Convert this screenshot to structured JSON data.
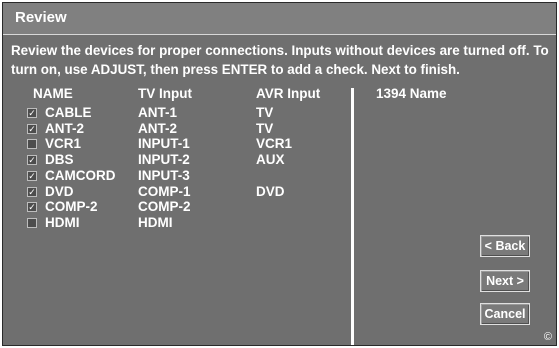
{
  "window": {
    "title": "Review"
  },
  "instructions": "Review the devices for proper connections. Inputs without devices are turned off. To turn on, use ADJUST, then press ENTER to add a check. Next to finish.",
  "columns": {
    "name": "NAME",
    "tv_input": "TV  Input",
    "avr_input": "AVR Input",
    "name_1394": "1394 Name"
  },
  "devices": [
    {
      "checked": true,
      "name": "CABLE",
      "tv_input": "ANT-1",
      "avr_input": "TV"
    },
    {
      "checked": true,
      "name": "ANT-2",
      "tv_input": "ANT-2",
      "avr_input": "TV"
    },
    {
      "checked": false,
      "name": "VCR1",
      "tv_input": "INPUT-1",
      "avr_input": "VCR1"
    },
    {
      "checked": true,
      "name": "DBS",
      "tv_input": "INPUT-2",
      "avr_input": "AUX"
    },
    {
      "checked": true,
      "name": "CAMCORD",
      "tv_input": "INPUT-3",
      "avr_input": ""
    },
    {
      "checked": true,
      "name": "DVD",
      "tv_input": "COMP-1",
      "avr_input": "DVD"
    },
    {
      "checked": true,
      "name": "COMP-2",
      "tv_input": "COMP-2",
      "avr_input": ""
    },
    {
      "checked": false,
      "name": "HDMI",
      "tv_input": "HDMI",
      "avr_input": ""
    }
  ],
  "buttons": {
    "back": "< Back",
    "next": "Next >",
    "cancel": "Cancel"
  },
  "copyright": "©"
}
